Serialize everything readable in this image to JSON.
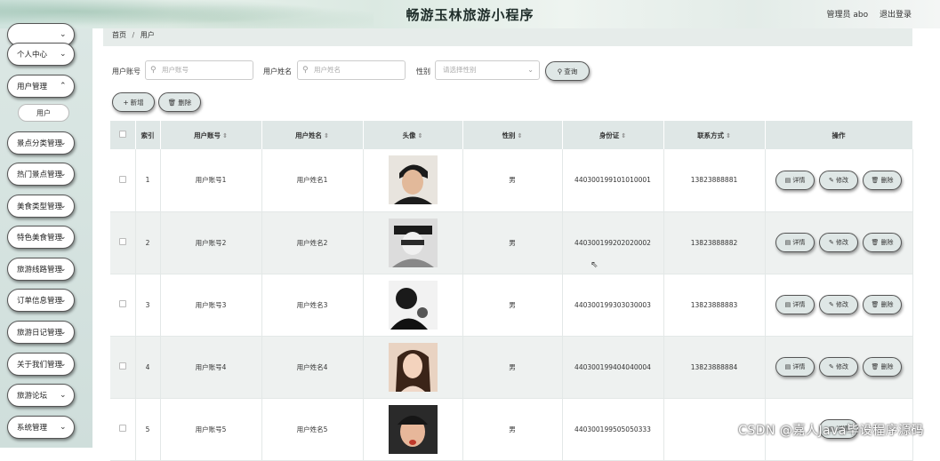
{
  "header": {
    "app_title": "畅游玉林旅游小程序",
    "admin_label": "管理员 abo",
    "logout_label": "退出登录"
  },
  "sidebar": {
    "items": [
      {
        "label": "个人中心"
      },
      {
        "label": "用户管理"
      },
      {
        "label": "景点分类管理"
      },
      {
        "label": "热门景点管理"
      },
      {
        "label": "美食类型管理"
      },
      {
        "label": "特色美食管理"
      },
      {
        "label": "旅游线路管理"
      },
      {
        "label": "订单信息管理"
      },
      {
        "label": "旅游日记管理"
      },
      {
        "label": "关于我们管理"
      },
      {
        "label": "旅游论坛"
      },
      {
        "label": "系统管理"
      }
    ],
    "sub_item": "用户"
  },
  "breadcrumb": {
    "home": "首页",
    "sep": "/",
    "current": "用户"
  },
  "filter": {
    "account_label": "用户账号",
    "account_placeholder": "用户账号",
    "name_label": "用户姓名",
    "name_placeholder": "用户姓名",
    "gender_label": "性别",
    "gender_placeholder": "请选择性别",
    "search_label": "查询"
  },
  "actions": {
    "add_label": "新增",
    "delete_label": "删除"
  },
  "table": {
    "headers": {
      "index": "索引",
      "account": "用户账号",
      "name": "用户姓名",
      "avatar": "头像",
      "gender": "性别",
      "id_card": "身份证",
      "phone": "联系方式",
      "ops": "操作"
    },
    "op_labels": {
      "detail": "详情",
      "edit": "修改",
      "delete": "删除"
    },
    "rows": [
      {
        "index": "1",
        "account": "用户账号1",
        "name": "用户姓名1",
        "gender": "男",
        "id_card": "440300199101010001",
        "phone": "13823888881"
      },
      {
        "index": "2",
        "account": "用户账号2",
        "name": "用户姓名2",
        "gender": "男",
        "id_card": "440300199202020002",
        "phone": "13823888882"
      },
      {
        "index": "3",
        "account": "用户账号3",
        "name": "用户姓名3",
        "gender": "男",
        "id_card": "440300199303030003",
        "phone": "13823888883"
      },
      {
        "index": "4",
        "account": "用户账号4",
        "name": "用户姓名4",
        "gender": "男",
        "id_card": "440300199404040004",
        "phone": "13823888884"
      },
      {
        "index": "5",
        "account": "用户账号5",
        "name": "用户姓名5",
        "gender": "男",
        "id_card": "440300199505050333",
        "phone": ""
      }
    ]
  },
  "watermark": "CSDN @嘉人Java毕设程序源码"
}
